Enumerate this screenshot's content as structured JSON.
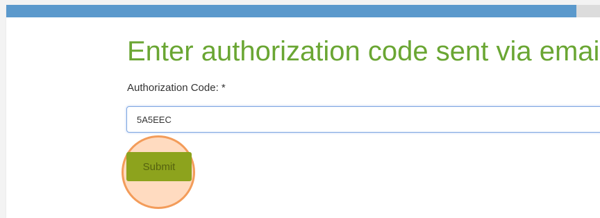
{
  "header": {
    "bar_color": "#5b99cc"
  },
  "form": {
    "title": "Enter authorization code sent via emai",
    "title_color": "#6aa633",
    "code_label": "Authorization Code: *",
    "code_value": "5A5EEC",
    "submit_label": "Submit",
    "submit_color": "#8da31d",
    "click_highlight_color": "#f39c5a"
  }
}
